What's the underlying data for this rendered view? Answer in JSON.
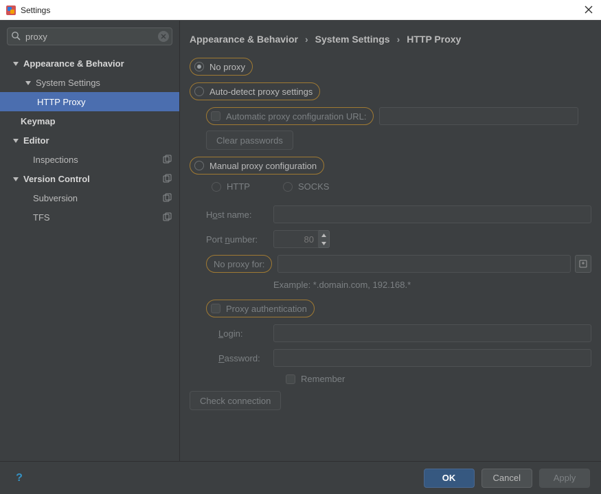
{
  "window": {
    "title": "Settings"
  },
  "search": {
    "value": "proxy"
  },
  "tree": {
    "appearance": "Appearance & Behavior",
    "system_settings": "System Settings",
    "http_proxy": "HTTP Proxy",
    "keymap": "Keymap",
    "editor": "Editor",
    "inspections": "Inspections",
    "version_control": "Version Control",
    "subversion": "Subversion",
    "tfs": "TFS"
  },
  "crumbs": {
    "a": "Appearance & Behavior",
    "b": "System Settings",
    "c": "HTTP Proxy"
  },
  "page": {
    "no_proxy": "No proxy",
    "auto_detect": "Auto-detect proxy settings",
    "auto_url": "Automatic proxy configuration URL:",
    "clear_passwords": "Clear passwords",
    "manual": "Manual proxy configuration",
    "http": "HTTP",
    "socks": "SOCKS",
    "host_pre": "H",
    "host_ul": "o",
    "host_post": "st name:",
    "port_pre": "Port ",
    "port_ul": "n",
    "port_post": "umber:",
    "port_value": "80",
    "noproxyfor": "No proxy for:",
    "example": "Example: *.domain.com, 192.168.*",
    "proxy_auth_pre": "Proxy ",
    "proxy_auth_ul": "a",
    "proxy_auth_post": "uthentication",
    "login_ul": "L",
    "login_post": "ogin:",
    "password_ul": "P",
    "password_post": "assword:",
    "remember_ul": "R",
    "remember_post": "emember",
    "check_conn": "Check connection"
  },
  "footer": {
    "ok": "OK",
    "cancel": "Cancel",
    "apply": "Apply"
  }
}
